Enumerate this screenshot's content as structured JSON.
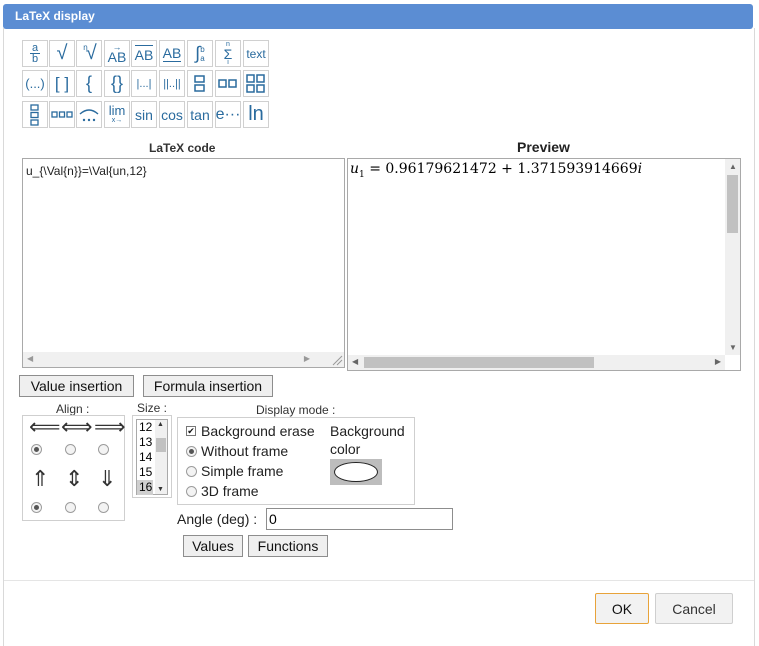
{
  "window": {
    "title": "LaTeX display"
  },
  "palette": {
    "row1": [
      "a/b",
      "√",
      "ⁿ√",
      "AB→",
      "AB‾",
      "AB_",
      "∫ab",
      "Σ",
      "text"
    ],
    "row2": [
      "(...)",
      "[ ]",
      "{",
      "{}",
      "|...|",
      "||..||",
      "▭▭v",
      "▭▭",
      "▦"
    ],
    "row3": [
      "▭▭▭v",
      "▭▭▭",
      "⌢...",
      "lim",
      "sin",
      "cos",
      "tan",
      "e...",
      "ln"
    ],
    "text_btn": "text",
    "lim_btn": "lim",
    "lim_sub": "x→",
    "sin_btn": "sin",
    "cos_btn": "cos",
    "tan_btn": "tan",
    "exp_btn": "e···",
    "ln_btn": "ln",
    "paren_btn": "(...)",
    "bracket_btn": "[ ]",
    "brace_btn": "{",
    "braces_btn": "{}",
    "abs_btn": "|...|",
    "norm_btn": "||..||",
    "frac_num": "a",
    "frac_den": "b",
    "sqrt_btn": "√",
    "nroot_btn": "√",
    "nroot_n": "n",
    "vec_btn": "AB",
    "bar_btn": "AB",
    "under_btn": "AB",
    "integral_btn": "∫",
    "int_b": "b",
    "int_a": "a",
    "sum_btn": "Σ",
    "sum_n": "n",
    "sum_i": "i"
  },
  "latex": {
    "label": "LaTeX code",
    "code": "u_{\\Val{n}}=\\Val{un,12}"
  },
  "preview": {
    "label": "Preview",
    "base": "u",
    "sub": "1",
    "rest": " = 0.96179621472 + 1.371593914669",
    "imag": "i"
  },
  "buttons": {
    "value_insertion": "Value insertion",
    "formula_insertion": "Formula insertion",
    "values": "Values",
    "functions": "Functions",
    "ok": "OK",
    "cancel": "Cancel"
  },
  "align": {
    "label": "Align :"
  },
  "size": {
    "label": "Size :",
    "options": [
      "12",
      "13",
      "14",
      "15",
      "16"
    ],
    "selected": "16"
  },
  "display_mode": {
    "label": "Display mode :",
    "background_erase": "Background erase",
    "background_erase_checked": true,
    "without_frame": "Without frame",
    "simple_frame": "Simple frame",
    "frame_3d": "3D frame",
    "selected": "Without frame",
    "background_color_1": "Background",
    "background_color_2": "color"
  },
  "angle": {
    "label": "Angle (deg) :",
    "value": "0"
  },
  "colors": {
    "title_bar": "#5b8dd3",
    "ok_border": "#e8a33a",
    "icon_blue": "#2a6b9e"
  }
}
